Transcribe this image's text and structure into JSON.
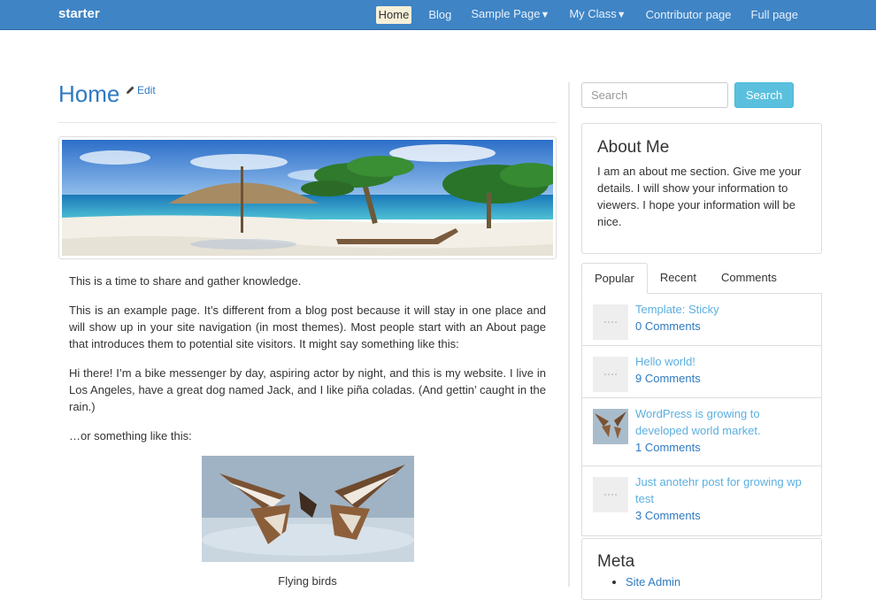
{
  "navbar": {
    "brand": "starter",
    "items": [
      {
        "label": "Home",
        "active": true
      },
      {
        "label": "Blog"
      },
      {
        "label": "Sample Page",
        "caret": "▼"
      },
      {
        "label": "My Class",
        "caret": "▼"
      },
      {
        "label": "Contributor page"
      },
      {
        "label": "Full page"
      }
    ]
  },
  "main": {
    "title": "Home",
    "edit_label": "Edit",
    "paragraphs": [
      "This is a time to share and gather knowledge.",
      "This is an example page. It’s different from a blog post because it will stay in one place and will show up in your site navigation (in most themes). Most people start with an About page that introduces them to potential site visitors. It might say something like this:",
      "Hi there! I’m a bike messenger by day, aspiring actor by night, and this is my website. I live in Los Angeles, have a great dog named Jack, and I like piña coladas. (And gettin’ caught in the rain.)",
      "…or something like this:"
    ],
    "figure_caption": "Flying birds"
  },
  "sidebar": {
    "search": {
      "placeholder": "Search",
      "button": "Search"
    },
    "about": {
      "title": "About Me",
      "text": "I am an about me section. Give me your details. I will show your information to viewers. I hope your information will be nice."
    },
    "tabs": [
      "Popular",
      "Recent",
      "Comments"
    ],
    "posts": [
      {
        "title": "Template: Sticky",
        "comments": "0 Comments",
        "thumb": "placeholder"
      },
      {
        "title": "Hello world!",
        "comments": "9 Comments",
        "thumb": "placeholder"
      },
      {
        "title": "WordPress is growing to developed world market.",
        "comments": "1 Comments",
        "thumb": "birds"
      },
      {
        "title": "Just anotehr post for growing wp test",
        "comments": "3 Comments",
        "thumb": "placeholder"
      }
    ],
    "meta": {
      "title": "Meta",
      "items": [
        "Site Admin"
      ]
    }
  },
  "colors": {
    "navbar": "#3f84c4",
    "link": "#2f7ac0",
    "button": "#5bc0de",
    "post_title": "#5bafe0"
  }
}
